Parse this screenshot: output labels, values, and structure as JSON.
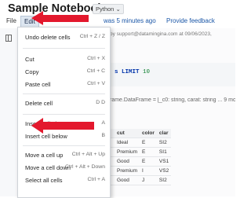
{
  "header": {
    "title": "Sample Notebook",
    "language": "Python",
    "language_arrow": "⌄",
    "last_edit": "was 5 minutes ago",
    "feedback": "Provide feedback"
  },
  "menubar": {
    "file": "File",
    "edit": "Edit"
  },
  "edit_menu": [
    {
      "label": "Undo delete cells",
      "shortcut": "Ctrl + Z / Z"
    },
    {
      "label": "Cut",
      "shortcut": "Ctrl + X"
    },
    {
      "label": "Copy",
      "shortcut": "Ctrl + C"
    },
    {
      "label": "Paste cell",
      "shortcut": "Ctrl + V"
    },
    {
      "label": "Delete cell",
      "shortcut": "D D"
    },
    {
      "label": "Insert cell above",
      "shortcut": "A"
    },
    {
      "label": "Insert cell below",
      "shortcut": "B"
    },
    {
      "label": "Move a cell up",
      "shortcut": "Ctrl + Alt + Up"
    },
    {
      "label": "Move a cell down",
      "shortcut": "Ctrl + Alt + Down"
    },
    {
      "label": "Select all cells",
      "shortcut": "Ctrl + A"
    }
  ],
  "notebook": {
    "cell_meta": "by support@datamingina.com at 09/06/2023,",
    "code_keyword": "s LIMIT",
    "code_number": "10",
    "schema": "rame.DataFrame = [_c0: string, carat: string ... 9 more",
    "table_headers": [
      "",
      "cut",
      "color",
      "clar"
    ],
    "table_rows": [
      [
        "",
        "Ideal",
        "E",
        "SI2"
      ],
      [
        "",
        "Premium",
        "E",
        "SI1"
      ],
      [
        "",
        "Good",
        "E",
        "VS1"
      ],
      [
        "",
        "Premium",
        "I",
        "VS2"
      ],
      [
        "",
        "Good",
        "J",
        "SI2"
      ]
    ]
  },
  "colors": {
    "arrow": "#e3182d",
    "link": "#1a56a7"
  },
  "icons": {
    "sidebar": "sidebar-toggle-icon",
    "annotation": "arrow-annotation"
  }
}
